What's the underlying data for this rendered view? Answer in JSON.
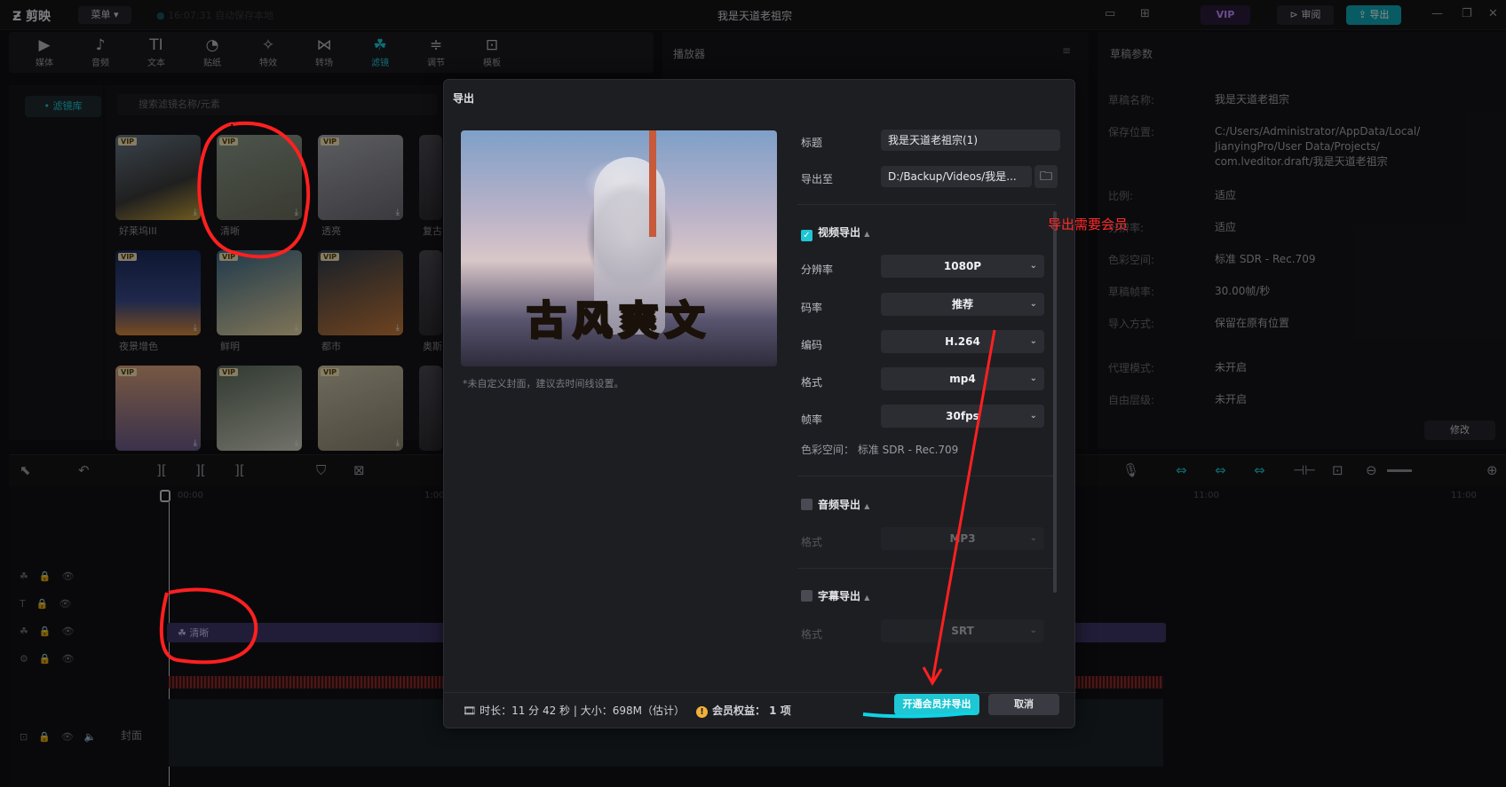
{
  "titlebar": {
    "logo": "剪映",
    "menu": "菜单 ▾",
    "autosave": "16:07:31 自动保存本地",
    "title": "我是天道老祖宗",
    "vip": "VIP",
    "review": "审阅",
    "export": "导出"
  },
  "toolbar": {
    "items": [
      {
        "icon": "▶",
        "label": "媒体"
      },
      {
        "icon": "♪",
        "label": "音频"
      },
      {
        "icon": "TI",
        "label": "文本"
      },
      {
        "icon": "◔",
        "label": "贴纸"
      },
      {
        "icon": "✧",
        "label": "特效"
      },
      {
        "icon": "⋈",
        "label": "转场"
      },
      {
        "icon": "☘",
        "label": "滤镜"
      },
      {
        "icon": "≑",
        "label": "调节"
      },
      {
        "icon": "⊡",
        "label": "模板"
      }
    ],
    "active_index": 6
  },
  "sidebar": {
    "library": "• 滤镜库"
  },
  "filters": {
    "search_placeholder": "搜索滤镜名称/元素",
    "tile_labels": [
      "好莱坞III",
      "清晰",
      "透亮",
      "复古",
      "夜景增色",
      "鲜明",
      "都市",
      "奥斯"
    ],
    "vip_badge": "VIP"
  },
  "player": {
    "heading": "播放器"
  },
  "params": {
    "heading": "草稿参数",
    "rows": [
      {
        "k": "草稿名称:",
        "v": "我是天道老祖宗"
      },
      {
        "k": "保存位置:",
        "v": "C:/Users/Administrator/AppData/Local/\nJianyingPro/User Data/Projects/\ncom.lveditor.draft/我是天道老祖宗"
      },
      {
        "k": "比例:",
        "v": "适应"
      },
      {
        "k": "分辨率:",
        "v": "适应"
      },
      {
        "k": "色彩空间:",
        "v": "标准 SDR - Rec.709"
      },
      {
        "k": "草稿帧率:",
        "v": "30.00帧/秒"
      },
      {
        "k": "导入方式:",
        "v": "保留在原有位置"
      },
      {
        "k": "代理模式:",
        "v": "未开启"
      },
      {
        "k": "自由层级:",
        "v": "未开启"
      }
    ],
    "modify": "修改"
  },
  "timeline": {
    "clip_label": "清晰",
    "cover_label": "封面",
    "time_marks": [
      "00:00",
      "1:00",
      "11:00",
      "11:00"
    ]
  },
  "dialog": {
    "title": "导出",
    "cover_text": "古风爽文",
    "cover_note": "*未自定义封面，建议去时间线设置。",
    "fields": {
      "title_label": "标题",
      "title_value": "我是天道老祖宗(1)",
      "export_to_label": "导出至",
      "export_to_value": "D:/Backup/Videos/我是..."
    },
    "video": {
      "section": "视频导出",
      "resolution_label": "分辨率",
      "resolution_value": "1080P",
      "bitrate_label": "码率",
      "bitrate_value": "推荐",
      "codec_label": "编码",
      "codec_value": "H.264",
      "format_label": "格式",
      "format_value": "mp4",
      "fps_label": "帧率",
      "fps_value": "30fps",
      "colorspace": "色彩空间：  标准 SDR - Rec.709"
    },
    "audio": {
      "section": "音频导出",
      "format_label": "格式",
      "format_value": "MP3"
    },
    "subtitle": {
      "section": "字幕导出",
      "format_label": "格式",
      "format_value": "SRT"
    },
    "footer": {
      "info": "时长：11 分 42 秒 | 大小：698M（估计）",
      "vip_info": "会员权益：  1 项",
      "vip_export": "开通会员并导出",
      "cancel": "取消"
    }
  },
  "annotation": {
    "text": "导出需要会员",
    "color": "#ff2a2a"
  },
  "colors": {
    "accent": "#1fc6d3",
    "annotation": "#ff2a2a",
    "clip": "#3d3566"
  }
}
